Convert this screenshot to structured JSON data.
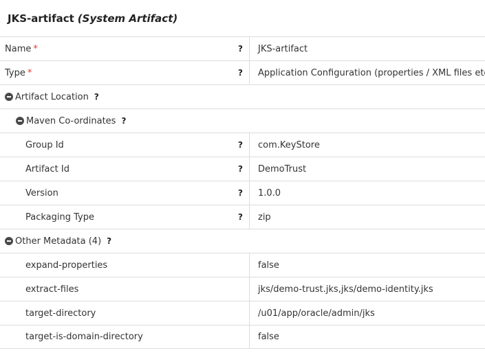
{
  "header": {
    "title": "JKS-artifact",
    "subtitle": "(System Artifact)"
  },
  "help_symbol": "?",
  "required_marker": "*",
  "fields": {
    "name": {
      "label": "Name",
      "value": "JKS-artifact"
    },
    "type": {
      "label": "Type",
      "value": "Application Configuration (properties / XML files etc.)"
    }
  },
  "sections": {
    "artifact_location": {
      "label": "Artifact Location"
    },
    "maven": {
      "label": "Maven Co-ordinates"
    },
    "other_metadata": {
      "label": "Other Metadata (4)"
    }
  },
  "maven": {
    "group_id": {
      "label": "Group Id",
      "value": "com.KeyStore"
    },
    "artifact_id": {
      "label": "Artifact Id",
      "value": "DemoTrust"
    },
    "version": {
      "label": "Version",
      "value": "1.0.0"
    },
    "packaging_type": {
      "label": "Packaging Type",
      "value": "zip"
    }
  },
  "metadata": [
    {
      "key": "expand-properties",
      "value": "false"
    },
    {
      "key": "extract-files",
      "value": "jks/demo-trust.jks,jks/demo-identity.jks"
    },
    {
      "key": "target-directory",
      "value": "/u01/app/oracle/admin/jks"
    },
    {
      "key": "target-is-domain-directory",
      "value": "false"
    }
  ]
}
